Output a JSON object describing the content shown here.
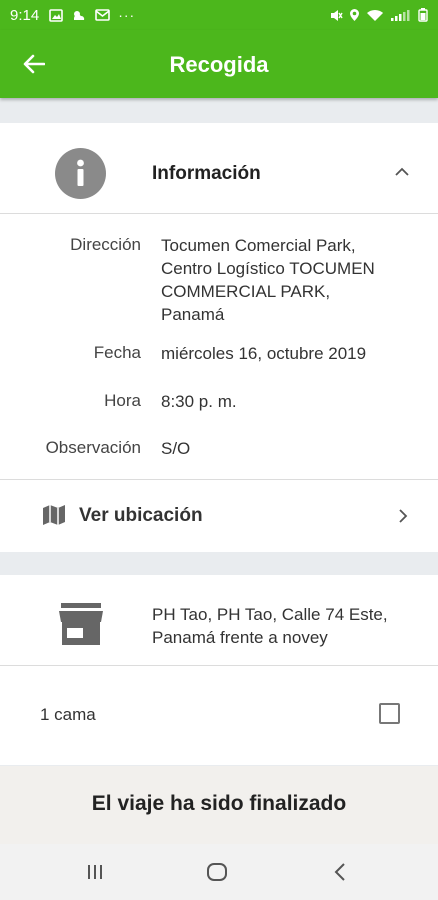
{
  "status_bar": {
    "time": "9:14",
    "left_icons": [
      "image-icon",
      "weather-icon",
      "mail-icon"
    ],
    "overflow": "···",
    "right_icons": [
      "mute-icon",
      "location-icon",
      "wifi-icon",
      "signal-icon",
      "battery-icon"
    ]
  },
  "app_bar": {
    "title": "Recogida",
    "background": "#4cb71c",
    "back_icon": "arrow-left-icon"
  },
  "info_section": {
    "title": "Información",
    "icon": "info-icon",
    "expand_icon": "chevron-up-icon",
    "rows": [
      {
        "label": "Dirección",
        "lines": [
          "Tocumen Comercial Park,",
          "Centro Logístico TOCUMEN",
          "COMMERCIAL PARK,",
          "Panamá"
        ]
      },
      {
        "label": "Fecha",
        "value": "miércoles 16, octubre 2019"
      },
      {
        "label": "Hora",
        "value": "8:30 p. m."
      },
      {
        "label": "Observación",
        "value": "S/O"
      }
    ],
    "location_link": {
      "label": "Ver ubicación",
      "icon": "map-icon",
      "chevron": "chevron-right-icon"
    }
  },
  "store_section": {
    "icon": "store-icon",
    "address_lines": [
      "PH Tao, PH Tao, Calle 74 Este,",
      "Panamá frente a novey"
    ],
    "item": {
      "label": "1 cama",
      "checked": false
    }
  },
  "footer": {
    "message": "El viaje ha sido finalizado"
  },
  "nav_bar": {
    "buttons": [
      "recent-apps-icon",
      "home-icon",
      "back-icon"
    ]
  }
}
